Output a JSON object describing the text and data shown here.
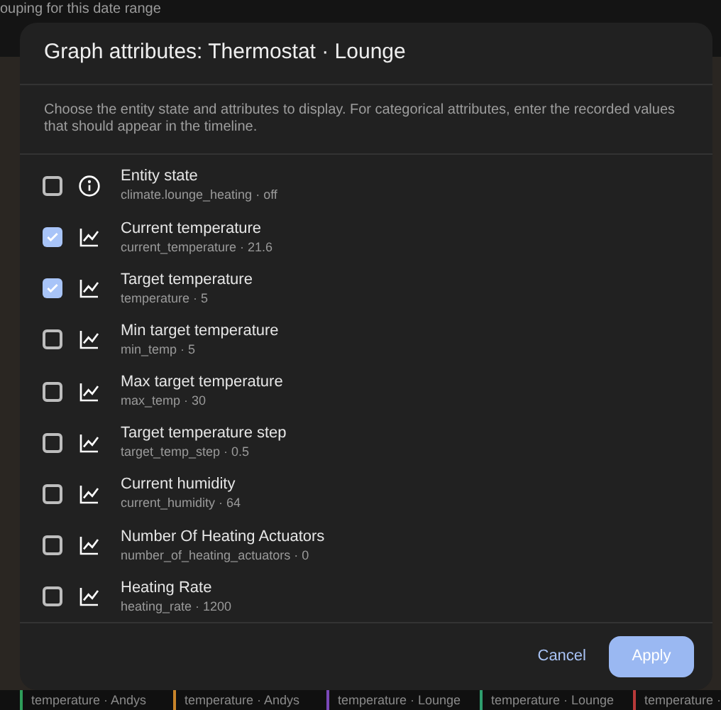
{
  "background": {
    "heading": "ouping for this date range",
    "legend": [
      {
        "label": "temperature · Andys",
        "color": "#2e9e5a"
      },
      {
        "label": "temperature · Andys",
        "color": "#c8842a"
      },
      {
        "label": "temperature · Lounge",
        "color": "#7a48b8"
      },
      {
        "label": "temperature · Lounge",
        "color": "#2e9e6e"
      },
      {
        "label": "temperature ·",
        "color": "#b83a3a"
      }
    ]
  },
  "dialog": {
    "title": "Graph attributes: Thermostat · Lounge",
    "description": "Choose the entity state and attributes to display. For categorical attributes, enter the recorded values that should appear in the timeline.",
    "attributes": [
      {
        "kind": "state",
        "name": "Entity state",
        "detail": "climate.lounge_heating · off",
        "checked": false
      },
      {
        "kind": "attribute",
        "name": "Current temperature",
        "detail": "current_temperature · 21.6",
        "checked": true
      },
      {
        "kind": "attribute",
        "name": "Target temperature",
        "detail": "temperature · 5",
        "checked": true
      },
      {
        "kind": "attribute",
        "name": "Min target temperature",
        "detail": "min_temp · 5",
        "checked": false
      },
      {
        "kind": "attribute",
        "name": "Max target temperature",
        "detail": "max_temp · 30",
        "checked": false
      },
      {
        "kind": "attribute",
        "name": "Target temperature step",
        "detail": "target_temp_step · 0.5",
        "checked": false
      },
      {
        "kind": "attribute",
        "name": "Current humidity",
        "detail": "current_humidity · 64",
        "checked": false
      },
      {
        "kind": "attribute",
        "name": "Number Of Heating Actuators",
        "detail": "number_of_heating_actuators · 0",
        "checked": false
      },
      {
        "kind": "attribute",
        "name": "Heating Rate",
        "detail": "heating_rate · 1200",
        "checked": false
      }
    ],
    "buttons": [
      {
        "kind": "text",
        "label": "Cancel"
      },
      {
        "kind": "filled",
        "label": "Apply"
      }
    ]
  }
}
